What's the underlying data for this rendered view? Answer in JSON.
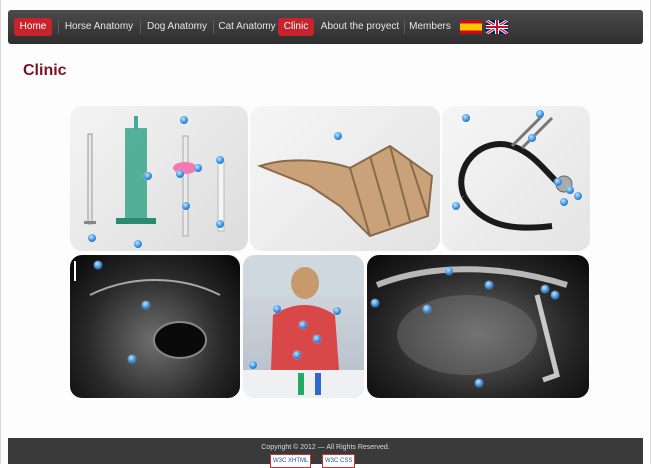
{
  "nav": {
    "items": [
      "Home",
      "Horse Anatomy",
      "Dog Anatomy",
      "Cat Anatomy",
      "Clinic",
      "About the proyect",
      "Members"
    ],
    "active_color": "#c8232c"
  },
  "flags": [
    "spain-flag-icon",
    "uk-flag-icon"
  ],
  "page": {
    "title": "Clinic",
    "title_color": "#7a1522"
  },
  "tiles": [
    {
      "name": "syringes",
      "alt": "syringes"
    },
    {
      "name": "muzzle",
      "alt": "muzzle"
    },
    {
      "name": "stethoscope",
      "alt": "stethoscope"
    },
    {
      "name": "ultrasound",
      "alt": "ultrasound"
    },
    {
      "name": "lab",
      "alt": "lab"
    },
    {
      "name": "xray",
      "alt": "xray"
    }
  ],
  "footer": {
    "copyright": "Copyright © 2012 — All Rights Reserved.",
    "badges": [
      "W3C XHTML",
      "W3C CSS"
    ]
  }
}
